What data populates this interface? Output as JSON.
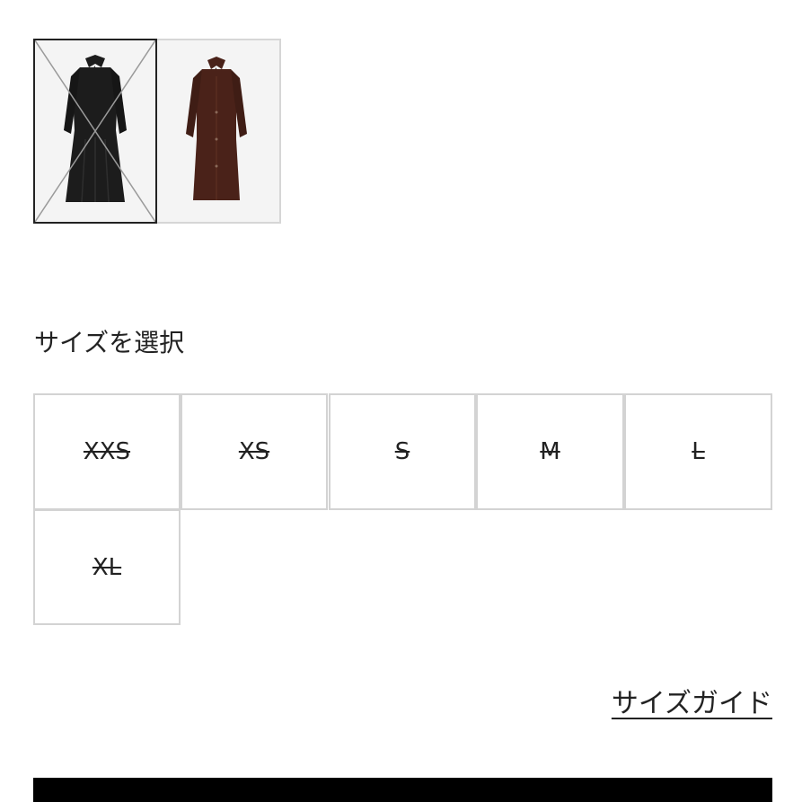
{
  "swatches": [
    {
      "name": "black",
      "color": "#1c1c1c",
      "selected": true,
      "unavailable": true
    },
    {
      "name": "brown",
      "color": "#4a2219",
      "selected": false,
      "unavailable": false
    }
  ],
  "size_section": {
    "heading": "サイズを選択",
    "sizes": [
      {
        "label": "XXS",
        "unavailable": true
      },
      {
        "label": "XS",
        "unavailable": true
      },
      {
        "label": "S",
        "unavailable": true
      },
      {
        "label": "M",
        "unavailable": true
      },
      {
        "label": "L",
        "unavailable": true
      },
      {
        "label": "XL",
        "unavailable": true
      }
    ]
  },
  "size_guide_label": "サイズガイド",
  "colors": {
    "primary": "#000000",
    "border": "#d3d3d3",
    "text": "#222222"
  }
}
